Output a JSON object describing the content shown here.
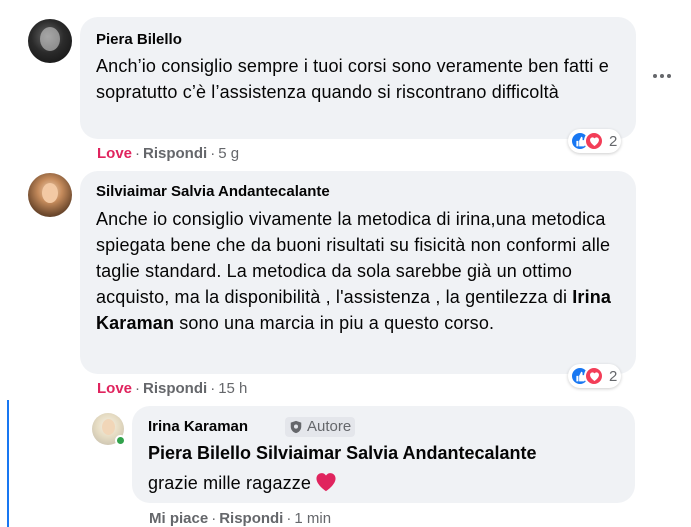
{
  "comments": [
    {
      "author": "Piera Bilello",
      "text": "Anch’io consiglio sempre i tuoi corsi sono veramente ben fatti e sopratutto c’è l’assistenza quando si riscontrano difficoltà",
      "actions": {
        "love": "Love",
        "reply": "Rispondi",
        "time": "5 g"
      },
      "reactions": {
        "icons": [
          "like-icon",
          "love-icon"
        ],
        "count": "2"
      }
    },
    {
      "author": "Silviaimar Salvia Andantecalante",
      "text_before": "Anche io consiglio vivamente la metodica di irina,una metodica spiegata bene che da buoni risultati su fisicità non conformi alle taglie standard. La metodica da sola sarebbe già un ottimo acquisto, ma la disponibilità , l'assistenza , la gentilezza di ",
      "mention": "Irina Karaman",
      "text_after": " sono una marcia in piu a questo corso.",
      "actions": {
        "love": "Love",
        "reply": "Rispondi",
        "time": "15 h"
      },
      "reactions": {
        "icons": [
          "like-icon",
          "love-icon"
        ],
        "count": "2"
      }
    }
  ],
  "reply": {
    "author": "Irina Karaman",
    "badge": "Autore",
    "mentions": "Piera Bilello Silviaimar Salvia Andantecalante",
    "text": "grazie mille ragazze",
    "emoji": "red-heart-icon",
    "actions": {
      "like": "Mi piace",
      "reply": "Rispondi",
      "time": "1 min"
    },
    "online": true
  },
  "colors": {
    "bubble": "#f0f2f5",
    "secondary_text": "#65676b",
    "love": "#e0245e",
    "like_blue": "#1877f2",
    "thread_line": "#1877f2",
    "online_green": "#31a24c"
  },
  "more_menu": {
    "icon": "more-horizontal-icon"
  }
}
